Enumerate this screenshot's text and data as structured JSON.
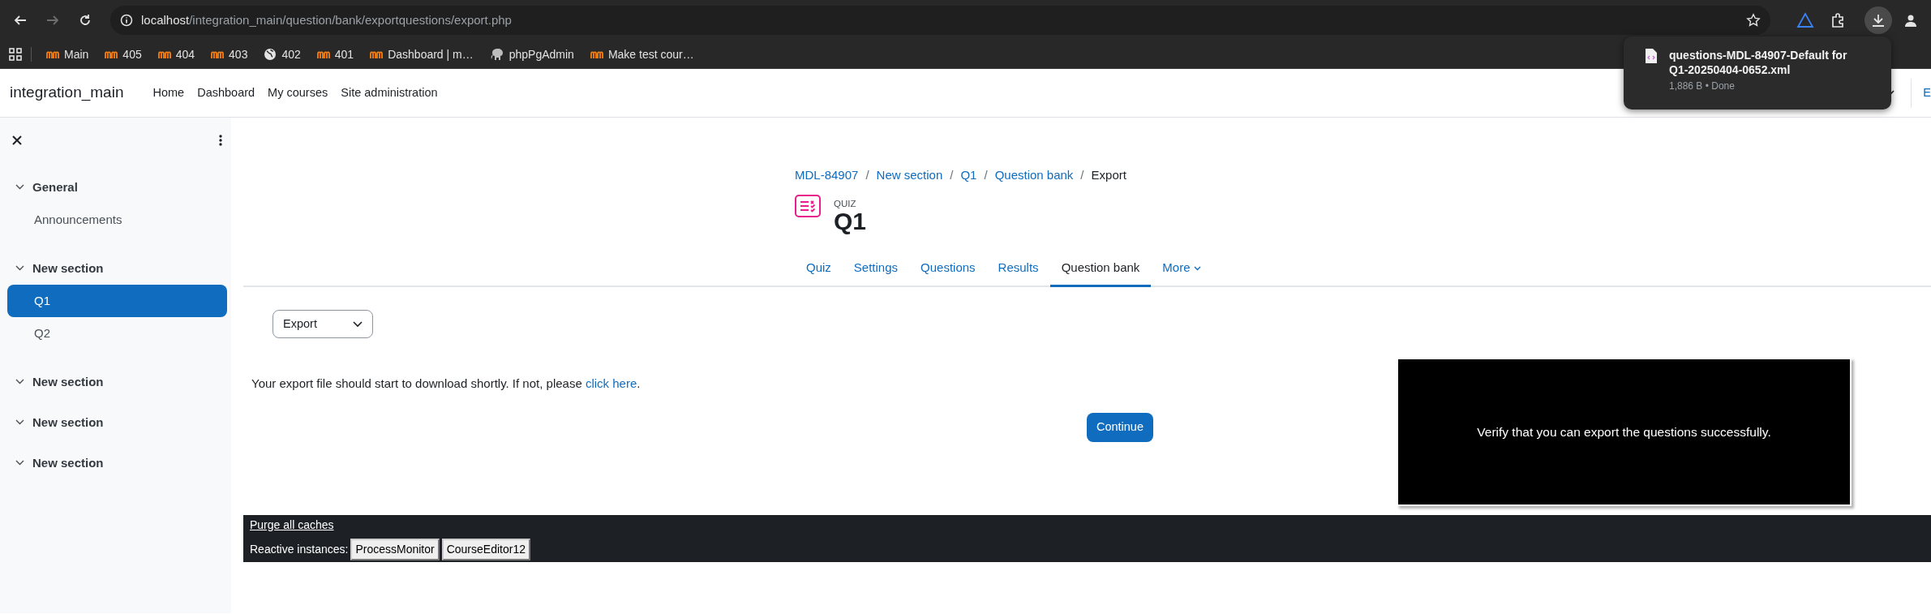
{
  "browser": {
    "nav_buttons": [
      {
        "kind": "back",
        "disabled": false
      },
      {
        "kind": "forward",
        "disabled": true
      },
      {
        "kind": "reload",
        "disabled": false
      }
    ],
    "url_host": "localhost",
    "url_path": "/integration_main/question/bank/exportquestions/export.php",
    "bookmarks": [
      {
        "label": "Main",
        "kind": "site"
      },
      {
        "label": "405",
        "kind": "site"
      },
      {
        "label": "404",
        "kind": "site"
      },
      {
        "label": "403",
        "kind": "site"
      },
      {
        "label": "402",
        "kind": "globe"
      },
      {
        "label": "401",
        "kind": "site"
      },
      {
        "label": "Dashboard | m…",
        "kind": "site"
      },
      {
        "label": "phpPgAdmin",
        "kind": "elephant"
      },
      {
        "label": "Make test cour…",
        "kind": "site"
      }
    ]
  },
  "download_popup": {
    "filename": "questions-MDL-84907-Default for Q1-20250404-0652.xml",
    "status": "1,886 B • Done"
  },
  "navbar": {
    "brand": "integration_main",
    "items": [
      {
        "label": "Home"
      },
      {
        "label": "Dashboard"
      },
      {
        "label": "My courses"
      },
      {
        "label": "Site administration"
      }
    ],
    "cut_item": "E"
  },
  "sidebar": {
    "sections": [
      {
        "title": "General",
        "expanded": true,
        "children": [
          {
            "label": "Announcements",
            "selected": false
          }
        ]
      },
      {
        "title": "New section",
        "expanded": true,
        "children": [
          {
            "label": "Q1",
            "selected": true
          },
          {
            "label": "Q2",
            "selected": false
          }
        ]
      },
      {
        "title": "New section",
        "expanded": true
      },
      {
        "title": "New section",
        "expanded": true
      },
      {
        "title": "New section",
        "expanded": true
      }
    ]
  },
  "breadcrumb": [
    {
      "label": "MDL-84907",
      "kind": "link"
    },
    {
      "label": "/",
      "kind": "separator"
    },
    {
      "label": "New section",
      "kind": "link"
    },
    {
      "label": "/",
      "kind": "separator"
    },
    {
      "label": "Q1",
      "kind": "link"
    },
    {
      "label": "/",
      "kind": "separator"
    },
    {
      "label": "Question bank",
      "kind": "link"
    },
    {
      "label": "/",
      "kind": "separator"
    },
    {
      "label": "Export",
      "kind": "current"
    }
  ],
  "header": {
    "module_type": "QUIZ",
    "title": "Q1"
  },
  "tabs": [
    {
      "label": "Quiz",
      "selected": false,
      "kind": "tab"
    },
    {
      "label": "Settings",
      "selected": false,
      "kind": "tab"
    },
    {
      "label": "Questions",
      "selected": false,
      "kind": "tab"
    },
    {
      "label": "Results",
      "selected": false,
      "kind": "tab"
    },
    {
      "label": "Question bank",
      "selected": true,
      "kind": "tab"
    },
    {
      "label": "More",
      "selected": false,
      "kind": "dropdown"
    }
  ],
  "action_select": {
    "value": "Export"
  },
  "message": {
    "text": "Your export file should start to download shortly. If not, please ",
    "link": "click here",
    "after": "."
  },
  "continue_button": "Continue",
  "overlay_note": "Verify that you can export the questions successfully.",
  "footer": {
    "purge_link": "Purge all caches",
    "reactive_label": "Reactive instances:",
    "instances": [
      "ProcessMonitor",
      "CourseEditor12"
    ]
  }
}
